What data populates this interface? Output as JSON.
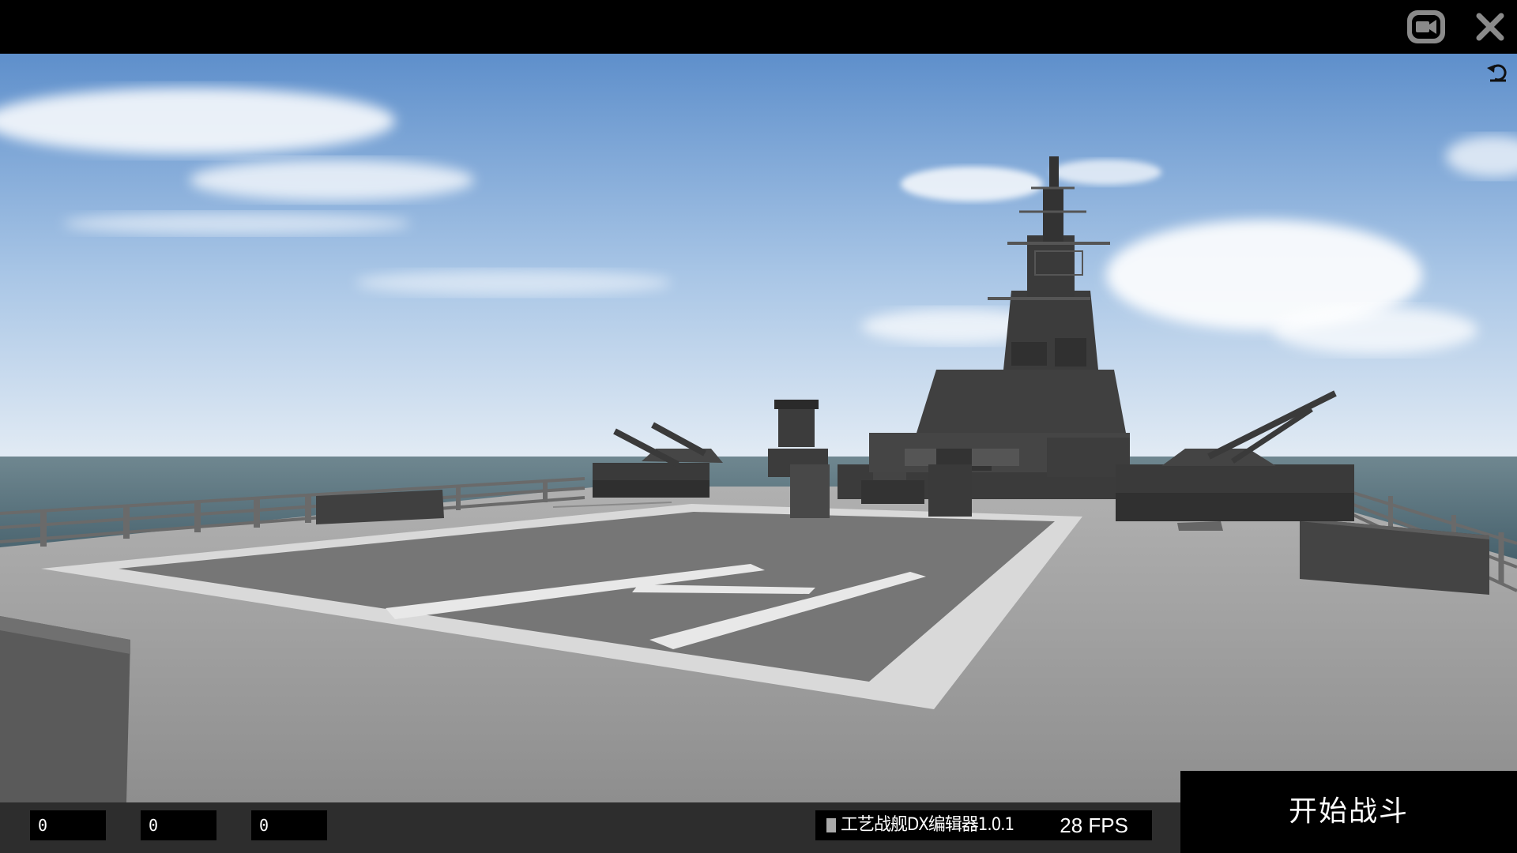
{
  "window": {
    "camera_icon": "camera-icon",
    "close_icon": "close-icon",
    "reset_icon": "undo-arrow-icon"
  },
  "counters": [
    {
      "value": "0"
    },
    {
      "value": "0"
    },
    {
      "value": "0"
    }
  ],
  "status": {
    "app_title": "工艺战舰DX编辑器1.0.1",
    "fps": "28 FPS"
  },
  "actions": {
    "start_battle": "开始战斗"
  },
  "colors": {
    "sky_top": "#5e8fcb",
    "sky_horizon": "#dfe9f3",
    "sea": "#4d6a75",
    "deck": "#9d9d9d",
    "ship": "#3e3e3e",
    "helipad": "#767676",
    "helipad_markings": "#ececec"
  }
}
